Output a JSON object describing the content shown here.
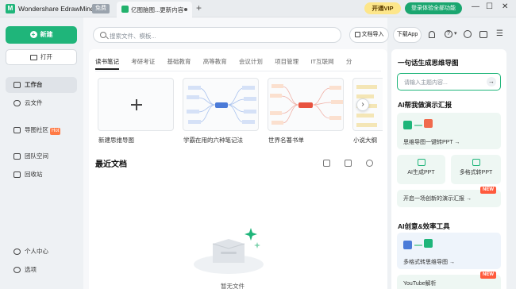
{
  "titlebar": {
    "app_name": "Wondershare EdrawMind",
    "free_badge": "免费",
    "tab_title": "亿图脑图...更新内容",
    "add_tab": "+",
    "vip_label": "开通VIP",
    "login_label": "登录体验全部功能"
  },
  "sidebar": {
    "new_label": "新建",
    "open_label": "打开",
    "items": [
      {
        "label": "工作台",
        "icon": "home-icon"
      },
      {
        "label": "云文件",
        "icon": "cloud-icon"
      },
      {
        "label": "导图社区",
        "icon": "community-icon",
        "badge": "Hot"
      },
      {
        "label": "团队空间",
        "icon": "team-icon"
      },
      {
        "label": "回收站",
        "icon": "trash-icon"
      }
    ],
    "bottom_items": [
      {
        "label": "个人中心",
        "icon": "user-icon"
      },
      {
        "label": "选项",
        "icon": "settings-icon"
      }
    ]
  },
  "search": {
    "placeholder": "搜索文件、模板..."
  },
  "toolbar": {
    "import_label": "文档导入",
    "download_label": "下载App"
  },
  "tabs": [
    "读书笔记",
    "考研考证",
    "基础教育",
    "高等教育",
    "会议计划",
    "项目管理",
    "IT互联网",
    "分"
  ],
  "templates": [
    {
      "label": "新建思维导图"
    },
    {
      "label": "学霸在用的六种笔记法"
    },
    {
      "label": "世界名著书单"
    },
    {
      "label": "小说大纲"
    }
  ],
  "recent": {
    "title": "最近文档",
    "empty_text": "暂无文件"
  },
  "right_panel": {
    "gen_title": "一句话生成思维导图",
    "gen_placeholder": "请输入主题内容...",
    "ppt_title": "AI帮我做演示汇报",
    "mind_to_ppt": "思维导图一键转PPT →",
    "ai_ppt": "AI生成PPT",
    "multi_ppt": "多格式转PPT",
    "start_journey": "开启一场创新的演示汇报 →",
    "new_badge": "NEW",
    "tools_title": "AI创意&效率工具",
    "multi_mind": "多格式转思维导图 →",
    "youtube": "YouTube解析"
  },
  "colors": {
    "brand": "#1fb57a",
    "vip": "#fde68a",
    "new_badge": "#ff5a3c"
  }
}
